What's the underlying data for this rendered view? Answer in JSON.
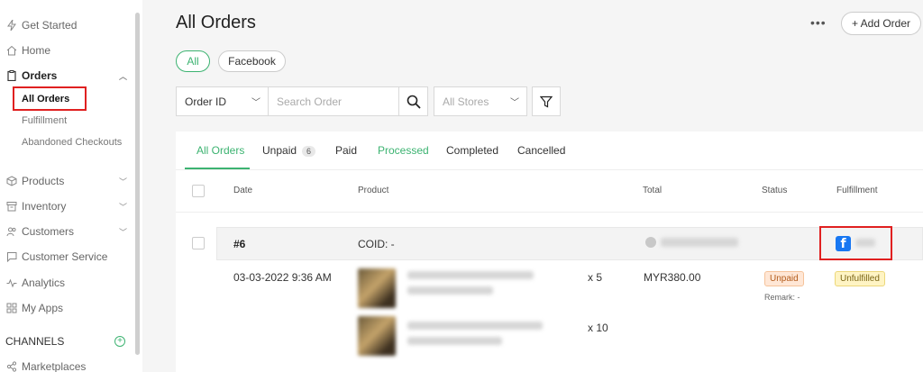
{
  "sidebar": {
    "items": [
      {
        "label": "Get Started",
        "icon": "lightning-icon"
      },
      {
        "label": "Home",
        "icon": "home-icon"
      },
      {
        "label": "Orders",
        "icon": "clipboard-icon"
      },
      {
        "label": "Products",
        "icon": "box-icon"
      },
      {
        "label": "Inventory",
        "icon": "archive-icon"
      },
      {
        "label": "Customers",
        "icon": "users-icon"
      },
      {
        "label": "Customer Service",
        "icon": "chat-icon"
      },
      {
        "label": "Analytics",
        "icon": "pulse-icon"
      },
      {
        "label": "My Apps",
        "icon": "apps-grid-icon"
      }
    ],
    "orders_sub": [
      "All Orders",
      "Fulfillment",
      "Abandoned Checkouts"
    ],
    "channels_label": "CHANNELS",
    "marketplaces_label": "Marketplaces"
  },
  "header": {
    "title": "All Orders",
    "more": "•••",
    "add_order": "+ Add Order"
  },
  "channel_pills": [
    "All",
    "Facebook"
  ],
  "filters": {
    "order_id": "Order ID",
    "search_placeholder": "Search Order",
    "stores": "All Stores"
  },
  "tabs": [
    {
      "label": "All Orders"
    },
    {
      "label": "Unpaid",
      "badge": "6"
    },
    {
      "label": "Paid"
    },
    {
      "label": "Processed"
    },
    {
      "label": "Completed"
    },
    {
      "label": "Cancelled"
    }
  ],
  "table": {
    "headers": [
      "Date",
      "Product",
      "Total",
      "Status",
      "Fulfillment"
    ]
  },
  "order": {
    "number": "#6",
    "coid": "COID: -",
    "date": "03-03-2022 9:36 AM",
    "items": [
      {
        "qty": "x 5"
      },
      {
        "qty": "x 10"
      }
    ],
    "total": "MYR380.00",
    "status": "Unpaid",
    "remark": "Remark: -",
    "fulfillment": "Unfulfilled",
    "channel_icon": "facebook-icon"
  },
  "colors": {
    "accent": "#3cb371",
    "highlight": "#e02020",
    "facebook": "#1877f2"
  }
}
